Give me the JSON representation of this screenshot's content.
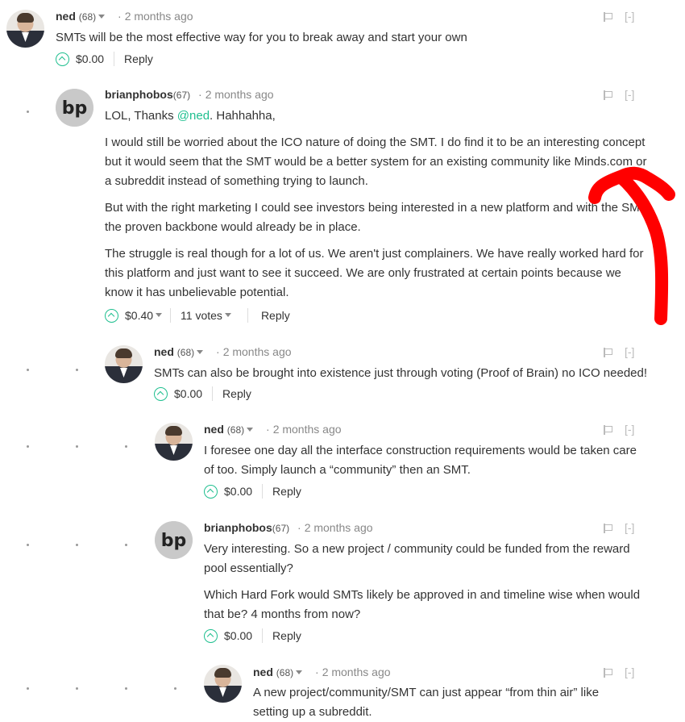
{
  "comments": [
    {
      "author": "ned",
      "rep": "(68)",
      "dot": "·",
      "time": "2 months ago",
      "paragraphs": [
        "SMTs will be the most effective way for you to break away and start your own"
      ],
      "payout": "$0.00",
      "reply": "Reply",
      "collapse": "[-]"
    },
    {
      "author": "brianphobos",
      "rep": "(67)",
      "dot": "·",
      "time": "2 months ago",
      "first_prefix": "LOL, Thanks ",
      "mention": "@ned",
      "first_suffix": ". Hahhahha,",
      "paragraphs": [
        "I would still be worried about the ICO nature of doing the SMT. I do find it to be an interesting concept but it would seem that the SMT would be a better system for an existing community like Minds.com or a subreddit instead of something trying to launch.",
        "But with the right marketing I could see investors being interested in a new platform and with the SMT the proven backbone would already be in place.",
        "The struggle is real though for a lot of us. We aren't just complainers. We have really worked hard for this platform and just want to see it succeed. We are only frustrated at certain points because we know it has unbelievable potential."
      ],
      "payout": "$0.40",
      "votes": "11 votes",
      "reply": "Reply",
      "collapse": "[-]"
    },
    {
      "author": "ned",
      "rep": "(68)",
      "dot": "·",
      "time": "2 months ago",
      "paragraphs": [
        "SMTs can also be brought into existence just through voting (Proof of Brain) no ICO needed!"
      ],
      "payout": "$0.00",
      "reply": "Reply",
      "collapse": "[-]"
    },
    {
      "author": "ned",
      "rep": "(68)",
      "dot": "·",
      "time": "2 months ago",
      "paragraphs": [
        "I foresee one day all the interface construction requirements would be taken care of too. Simply launch a “community” then an SMT."
      ],
      "payout": "$0.00",
      "reply": "Reply",
      "collapse": "[-]"
    },
    {
      "author": "brianphobos",
      "rep": "(67)",
      "dot": "·",
      "time": "2 months ago",
      "paragraphs": [
        "Very interesting. So a new project / community could be funded from the reward pool essentially?",
        "Which Hard Fork would SMTs likely be approved in and timeline wise when would that be? 4 months from now?"
      ],
      "payout": "$0.00",
      "reply": "Reply",
      "collapse": "[-]"
    },
    {
      "author": "ned",
      "rep": "(68)",
      "dot": "·",
      "time": "2 months ago",
      "paragraphs": [
        "A new project/community/SMT can just appear “from thin air” like setting up a subreddit."
      ],
      "collapse": "[-]"
    }
  ],
  "colors": {
    "accent": "#1fbf8f",
    "annotation": "#ff0000"
  },
  "icons": [
    "upvote-icon",
    "flag-icon",
    "caret-down-icon",
    "avatar-ned",
    "avatar-brianphobos"
  ]
}
